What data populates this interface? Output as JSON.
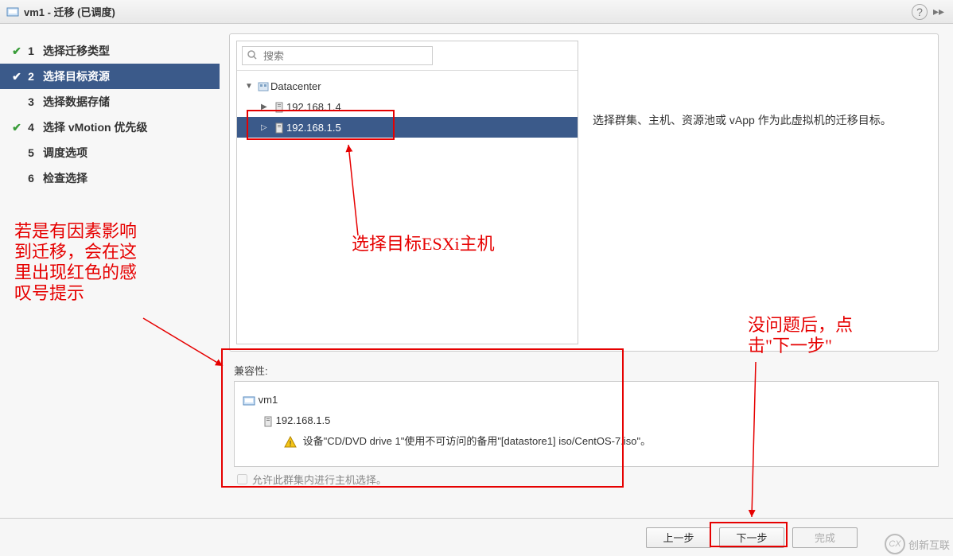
{
  "title": "vm1 - 迁移 (已调度)",
  "sidebar": {
    "steps": [
      {
        "num": "1",
        "label": "选择迁移类型",
        "checked": true
      },
      {
        "num": "2",
        "label": "选择目标资源",
        "checked": true,
        "active": true
      },
      {
        "num": "3",
        "label": "选择数据存储"
      },
      {
        "num": "4",
        "label": "选择 vMotion 优先级",
        "checked": true
      },
      {
        "num": "5",
        "label": "调度选项"
      },
      {
        "num": "6",
        "label": "检查选择"
      }
    ]
  },
  "search": {
    "placeholder": "搜索"
  },
  "tree": {
    "root": "Datacenter",
    "hosts": [
      "192.168.1.4",
      "192.168.1.5"
    ],
    "selected": "192.168.1.5"
  },
  "help_text": "选择群集、主机、资源池或 vApp 作为此虚拟机的迁移目标。",
  "compat": {
    "label": "兼容性:",
    "vm": "vm1",
    "host": "192.168.1.5",
    "warning": "设备\"CD/DVD drive 1\"使用不可访问的备用\"[datastore1] iso/CentOS-7.iso\"。"
  },
  "allow_host_select": "允许此群集内进行主机选择。",
  "buttons": {
    "back": "上一步",
    "next": "下一步",
    "finish": "完成"
  },
  "annotations": {
    "left": "若是有因素影响\n到迁移，会在这\n里出现红色的感\n叹号提示",
    "mid": "选择目标ESXi主机",
    "right": "没问题后，点\n击\"下一步\""
  },
  "watermark": "创新互联"
}
